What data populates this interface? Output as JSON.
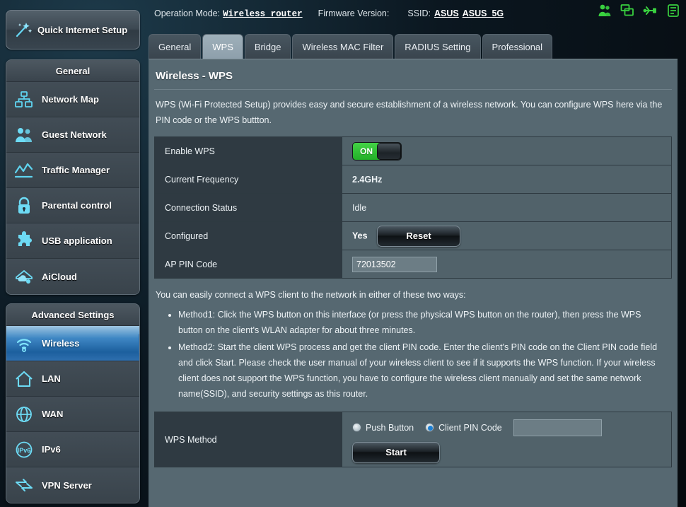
{
  "sidebar": {
    "quick_setup": {
      "label": "Quick Internet Setup",
      "icon": "magic-wand-icon"
    },
    "general_header": "General",
    "general_items": [
      {
        "label": "Network Map",
        "icon": "network-map-icon"
      },
      {
        "label": "Guest Network",
        "icon": "guest-network-icon"
      },
      {
        "label": "Traffic Manager",
        "icon": "traffic-manager-icon"
      },
      {
        "label": "Parental control",
        "icon": "lock-icon"
      },
      {
        "label": "USB application",
        "icon": "puzzle-icon"
      },
      {
        "label": "AiCloud",
        "icon": "cloud-icon"
      }
    ],
    "advanced_header": "Advanced Settings",
    "advanced_items": [
      {
        "label": "Wireless",
        "icon": "wifi-icon",
        "active": true
      },
      {
        "label": "LAN",
        "icon": "home-icon",
        "active": false
      },
      {
        "label": "WAN",
        "icon": "globe-icon",
        "active": false
      },
      {
        "label": "IPv6",
        "icon": "ipv6-icon",
        "active": false
      },
      {
        "label": "VPN Server",
        "icon": "vpn-icon",
        "active": false
      }
    ]
  },
  "header": {
    "operation_mode_label": "Operation Mode:",
    "operation_mode_value": "Wireless router",
    "firmware_label": "Firmware Version:",
    "firmware_value": "",
    "ssid_label": "SSID:",
    "ssid_1": "ASUS",
    "ssid_2": "ASUS_5G",
    "status_icons": [
      "clients-icon",
      "screen-icon",
      "usb-icon",
      "printer-icon"
    ],
    "status_icon_color": "#39d13f"
  },
  "tabs": [
    {
      "label": "General",
      "active": false
    },
    {
      "label": "WPS",
      "active": true
    },
    {
      "label": "Bridge",
      "active": false
    },
    {
      "label": "Wireless MAC Filter",
      "active": false
    },
    {
      "label": "RADIUS Setting",
      "active": false
    },
    {
      "label": "Professional",
      "active": false
    }
  ],
  "page": {
    "title": "Wireless - WPS",
    "intro": "WPS (Wi-Fi Protected Setup) provides easy and secure establishment of a wireless network. You can configure WPS here via the PIN code or the WPS buttton.",
    "body_intro": "You can easily connect a WPS client to the network in either of these two ways:",
    "methods": [
      "Method1: Click the WPS button on this interface (or press the physical WPS button on the router), then press the WPS button on the client's WLAN adapter for about three minutes.",
      "Method2: Start the client WPS process and get the client PIN code. Enter the client's PIN code on the Client PIN code field and click Start. Please check the user manual of your wireless client to see if it supports the WPS function. If your wireless client does not support the WPS function, you have to configure the wireless client manually and set the same network name(SSID), and security settings as this router."
    ]
  },
  "settings": {
    "enable_wps": {
      "label": "Enable WPS",
      "state": "ON"
    },
    "current_frequency": {
      "label": "Current Frequency",
      "value": "2.4GHz"
    },
    "connection_status": {
      "label": "Connection Status",
      "value": "Idle",
      "color": "#d8a43c"
    },
    "configured": {
      "label": "Configured",
      "value": "Yes",
      "reset_button": "Reset"
    },
    "ap_pin_code": {
      "label": "AP PIN Code",
      "value": "72013502"
    }
  },
  "wps_method": {
    "label": "WPS Method",
    "push_button": {
      "label": "Push Button",
      "selected": false
    },
    "client_pin": {
      "label": "Client PIN Code",
      "selected": true,
      "value": "",
      "placeholder": ""
    },
    "start_button": "Start"
  }
}
